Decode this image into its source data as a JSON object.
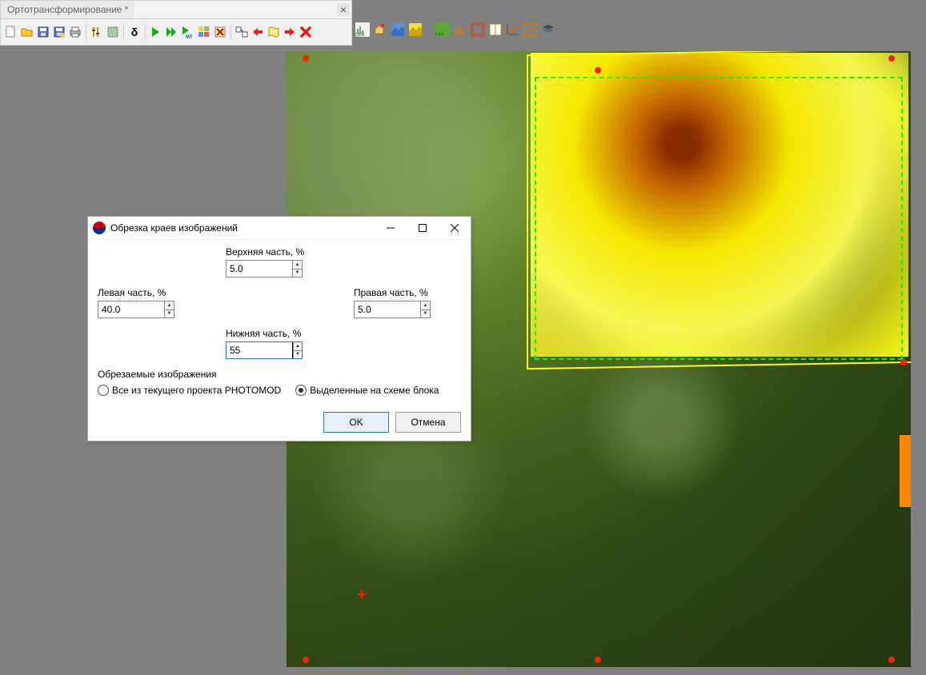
{
  "toolbar": {
    "tab_title": "Ортотрансформирование *",
    "tab_close": "×",
    "delta_symbol": "δ"
  },
  "second_toolbar": {
    "dem_label": "DEM",
    "diff_label": "DIFF"
  },
  "dialog": {
    "title": "Обрезка краев изображений",
    "top_label": "Верхняя часть, %",
    "top_value": "5.0",
    "left_label": "Левая часть, %",
    "left_value": "40.0",
    "right_label": "Правая часть, %",
    "right_value": "5.0",
    "bottom_label": "Нижняя часть, %",
    "bottom_value": "55",
    "group_label": "Обрезаемые изображения",
    "radio_all": "Все из текущего проекта PHOTOMOD",
    "radio_selected": "Выделенные на схеме блока",
    "ok": "OK",
    "cancel": "Отмена"
  }
}
